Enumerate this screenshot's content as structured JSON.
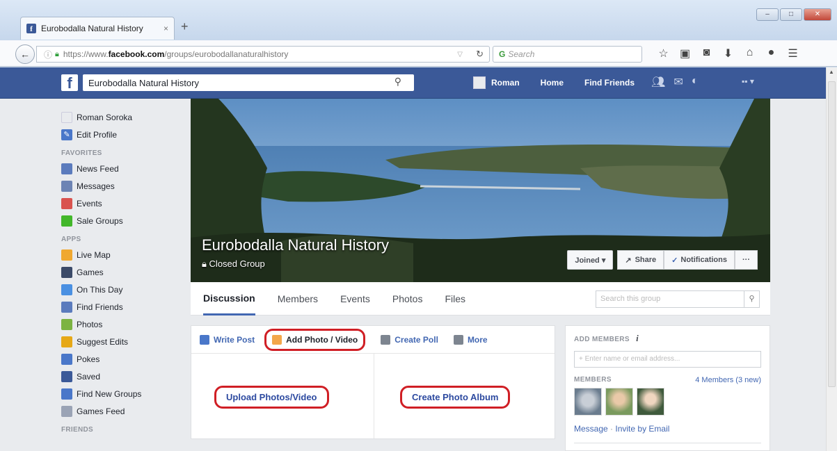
{
  "browser": {
    "tab_title": "Eurobodalla Natural History",
    "tab_close": "×",
    "new_tab": "+",
    "url_prefix": "https://www.",
    "url_domain": "facebook.com",
    "url_path": "/groups/eurobodallanaturalhistory",
    "search_placeholder": "Search"
  },
  "facebook": {
    "search_value": "Eurobodalla Natural History",
    "user_name": "Roman",
    "home": "Home",
    "find_friends": "Find Friends"
  },
  "sidebar": {
    "profile_name": "Roman Soroka",
    "edit_profile": "Edit Profile",
    "favorites_heading": "FAVORITES",
    "favorites": [
      {
        "label": "News Feed",
        "icon": "news-feed-icon",
        "color": "#5b7bbd"
      },
      {
        "label": "Messages",
        "icon": "messages-icon",
        "color": "#6d84b4"
      },
      {
        "label": "Events",
        "icon": "events-icon",
        "color": "#d9534f"
      },
      {
        "label": "Sale Groups",
        "icon": "sale-groups-icon",
        "color": "#42b72a"
      }
    ],
    "apps_heading": "APPS",
    "apps": [
      {
        "label": "Live Map",
        "icon": "live-map-icon",
        "color": "#f0a830"
      },
      {
        "label": "Games",
        "icon": "games-icon",
        "color": "#3b4a68"
      },
      {
        "label": "On This Day",
        "icon": "on-this-day-icon",
        "color": "#4a90e2"
      },
      {
        "label": "Find Friends",
        "icon": "find-friends-icon",
        "color": "#5b7bbd"
      },
      {
        "label": "Photos",
        "icon": "photos-icon",
        "color": "#7cb342"
      },
      {
        "label": "Suggest Edits",
        "icon": "suggest-edits-icon",
        "color": "#e6a817"
      },
      {
        "label": "Pokes",
        "icon": "pokes-icon",
        "color": "#4a77c9"
      },
      {
        "label": "Saved",
        "icon": "saved-icon",
        "color": "#3b5998"
      },
      {
        "label": "Find New Groups",
        "icon": "find-new-groups-icon",
        "color": "#4a77c9"
      },
      {
        "label": "Games Feed",
        "icon": "games-feed-icon",
        "color": "#9aa3b5"
      }
    ],
    "friends_heading": "FRIENDS"
  },
  "group": {
    "name": "Eurobodalla Natural History",
    "privacy": "Closed Group",
    "joined": "Joined ▾",
    "share": "Share",
    "notifications": "Notifications",
    "more": "···",
    "tabs": [
      "Discussion",
      "Members",
      "Events",
      "Photos",
      "Files"
    ],
    "search_placeholder": "Search this group"
  },
  "composer": {
    "write_post": "Write Post",
    "add_photo_video": "Add Photo / Video",
    "create_poll": "Create Poll",
    "more": "More",
    "upload": "Upload Photos/Video",
    "create_album": "Create Photo Album",
    "highlight_color": "#d01f25"
  },
  "right": {
    "add_members": "ADD MEMBERS",
    "add_placeholder": "+ Enter name or email address...",
    "members_label": "MEMBERS",
    "members_count": "4 Members (3 new)",
    "message": "Message",
    "dot": " · ",
    "invite": "Invite by Email"
  },
  "colors": {
    "facebook_blue": "#3b5998",
    "link_blue": "#4267b2"
  }
}
